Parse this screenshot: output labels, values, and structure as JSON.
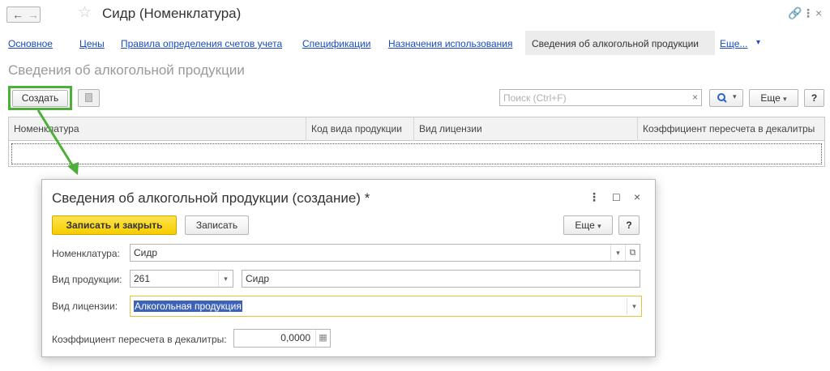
{
  "window": {
    "back_icon": "←",
    "forward_icon": "→",
    "star_icon": "☆",
    "title": "Сидр (Номенклатура)",
    "link_icon": "🔗",
    "more_icon": "⋮",
    "close_icon": "×"
  },
  "tabs": [
    {
      "label": "Основное"
    },
    {
      "label": "Цены"
    },
    {
      "label": "Правила определения счетов учета"
    },
    {
      "label": "Спецификации"
    },
    {
      "label": "Назначения использования"
    },
    {
      "label": "Сведения об алкогольной продукции"
    },
    {
      "label": "Еще..."
    }
  ],
  "tabs_more_arrow": "▾",
  "section_title": "Сведения об алкогольной продукции",
  "toolbar": {
    "create_label": "Создать",
    "search_placeholder": "Поиск (Ctrl+F)",
    "search_clear": "×",
    "search_btn_arrow": "▾",
    "more_label": "Еще",
    "more_arrow": "▾",
    "help_label": "?"
  },
  "table": {
    "columns": [
      "Номенклатура",
      "Код вида продукции",
      "Вид лицензии",
      "Коэффициент пересчета в декалитры"
    ]
  },
  "dialog": {
    "title": "Сведения об алкогольной продукции (создание) *",
    "more_icon": "⋮",
    "maximize_icon": "☐",
    "close_icon": "×",
    "save_close_label": "Записать и закрыть",
    "save_label": "Записать",
    "more_label": "Еще",
    "more_arrow": "▾",
    "help_label": "?",
    "nomenclature_label": "Номенклатура:",
    "nomenclature_value": "Сидр",
    "product_type_label": "Вид продукции:",
    "product_type_code": "261",
    "product_type_name": "Сидр",
    "license_label": "Вид лицензии:",
    "license_value": "Алкогольная продукция",
    "coef_label": "Коэффициент пересчета в декалитры:",
    "coef_value": "0,0000",
    "dropdown_arrow": "▾",
    "open_icon": "⧉",
    "calc_icon": "▦"
  },
  "colors": {
    "link": "#1a4bbf",
    "highlight_green": "#4caf38",
    "primary_yellow": "#f6cc00",
    "selection_blue": "#3d63b8"
  }
}
